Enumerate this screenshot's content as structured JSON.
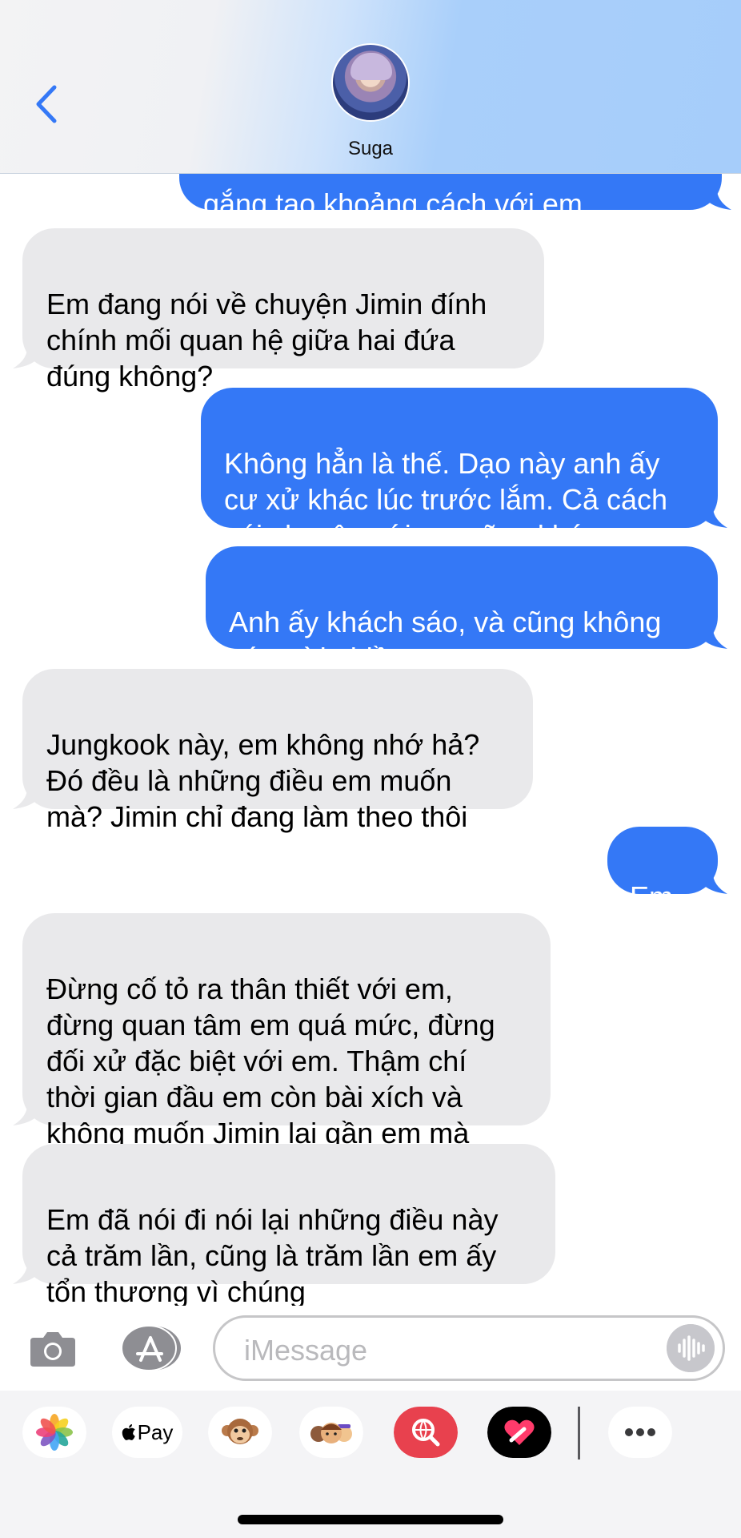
{
  "header": {
    "contact_name": "Suga"
  },
  "messages": [
    {
      "id": "m0",
      "from": "me",
      "text": "gắng tạo khoảng cách với em.."
    },
    {
      "id": "m1",
      "from": "them",
      "text": "Em đang nói về chuyện Jimin đính\nchính mối quan hệ giữa hai đứa\nđúng không?"
    },
    {
      "id": "m2",
      "from": "me",
      "text": "Không hẳn là thế. Dạo này anh ấy\ncư xử khác lúc trước lắm. Cả cách\nnói chuyện với em cũng khác."
    },
    {
      "id": "m3",
      "from": "me",
      "text": "Anh ấy khách sáo, và cũng không\ncó cười nhiều..."
    },
    {
      "id": "m4",
      "from": "them",
      "text": "Jungkook này, em không nhớ hả?\nĐó đều là những điều em muốn\nmà? Jimin chỉ đang làm theo thôi"
    },
    {
      "id": "m5",
      "from": "me",
      "text": "Em-"
    },
    {
      "id": "m6",
      "from": "them",
      "text": "Đừng cố tỏ ra thân thiết với em,\nđừng quan tâm em quá mức, đừng\nđối xử đặc biệt với em. Thậm chí\nthời gian đầu em còn bài xích và\nkhông muốn Jimin lại gần em mà"
    },
    {
      "id": "m7",
      "from": "them",
      "text": "Em đã nói đi nói lại những điều này\ncả trăm lần, cũng là trăm lần em ấy\ntổn thương vì chúng"
    }
  ],
  "input": {
    "placeholder": "iMessage"
  },
  "apps": [
    {
      "name": "photos-icon",
      "label": ""
    },
    {
      "name": "apple-pay-icon",
      "label": "Pay"
    },
    {
      "name": "animoji-icon",
      "label": ""
    },
    {
      "name": "memoji-icon",
      "label": ""
    },
    {
      "name": "web-search-icon",
      "label": ""
    },
    {
      "name": "digital-touch-icon",
      "label": ""
    },
    {
      "name": "more-apps-icon",
      "label": ""
    }
  ],
  "colors": {
    "outgoing_bubble": "#3478f6",
    "incoming_bubble": "#e9e9eb",
    "accent": "#3478f6"
  }
}
